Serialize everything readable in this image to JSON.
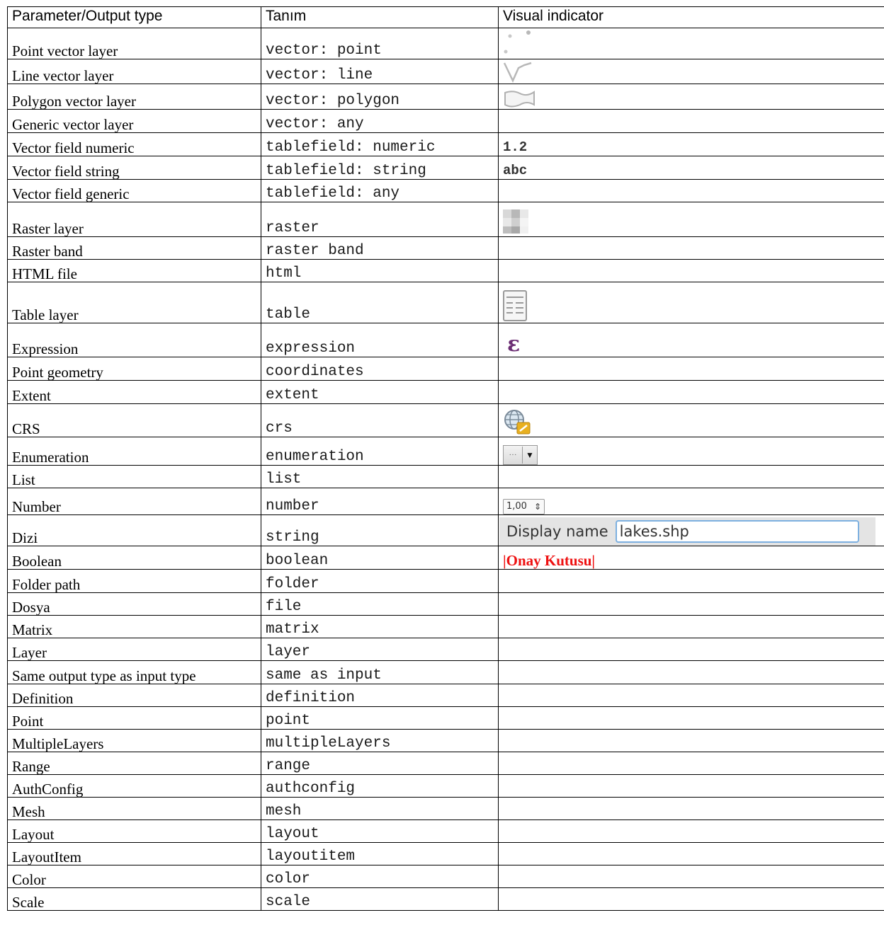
{
  "headers": [
    "Parameter/Output type",
    "Tanım",
    "Visual indicator"
  ],
  "rows": [
    {
      "name": "Point vector layer",
      "code": "vector: point",
      "icon": "point-vector-icon"
    },
    {
      "name": "Line vector layer",
      "code": "vector: line",
      "icon": "line-vector-icon"
    },
    {
      "name": "Polygon vector layer",
      "code": "vector: polygon",
      "icon": "polygon-vector-icon"
    },
    {
      "name": "Generic vector layer",
      "code": "vector: any",
      "icon": ""
    },
    {
      "name": "Vector field numeric",
      "code": "tablefield: numeric",
      "visual_text": "1.2"
    },
    {
      "name": "Vector field string",
      "code": "tablefield: string",
      "visual_text": "abc"
    },
    {
      "name": "Vector field generic",
      "code": "tablefield: any",
      "icon": ""
    },
    {
      "name": "Raster layer",
      "code": "raster",
      "icon": "raster-icon"
    },
    {
      "name": "Raster band",
      "code": "raster band",
      "icon": ""
    },
    {
      "name": "HTML file",
      "code": "html",
      "icon": ""
    },
    {
      "name": "Table layer",
      "code": "table",
      "icon": "table-icon"
    },
    {
      "name": "Expression",
      "code": "expression",
      "icon": "expression-epsilon-icon"
    },
    {
      "name": "Point geometry",
      "code": "coordinates",
      "icon": ""
    },
    {
      "name": "Extent",
      "code": "extent",
      "icon": ""
    },
    {
      "name": "CRS",
      "code": "crs",
      "icon": "crs-globe-icon"
    },
    {
      "name": "Enumeration",
      "code": "enumeration",
      "icon": "enumeration-combo-icon"
    },
    {
      "name": "List",
      "code": "list",
      "icon": ""
    },
    {
      "name": "Number",
      "code": "number",
      "spin_value": "1,00"
    },
    {
      "name": "Dizi",
      "code": "string",
      "display_label": "Display name",
      "display_value": "lakes.shp"
    },
    {
      "name": "Boolean",
      "code": "boolean",
      "visual_text": "|Onay Kutusu|"
    },
    {
      "name": "Folder path",
      "code": "folder",
      "icon": ""
    },
    {
      "name": "Dosya",
      "code": "file",
      "icon": ""
    },
    {
      "name": "Matrix",
      "code": "matrix",
      "icon": ""
    },
    {
      "name": "Layer",
      "code": "layer",
      "icon": ""
    },
    {
      "name": "Same output type as input type",
      "code": "same as input",
      "icon": ""
    },
    {
      "name": "Definition",
      "code": "definition",
      "icon": ""
    },
    {
      "name": "Point",
      "code": "point",
      "icon": ""
    },
    {
      "name": "MultipleLayers",
      "code": "multipleLayers",
      "icon": ""
    },
    {
      "name": "Range",
      "code": "range",
      "icon": ""
    },
    {
      "name": "AuthConfig",
      "code": "authconfig",
      "icon": ""
    },
    {
      "name": "Mesh",
      "code": "mesh",
      "icon": ""
    },
    {
      "name": "Layout",
      "code": "layout",
      "icon": ""
    },
    {
      "name": "LayoutItem",
      "code": "layoutitem",
      "icon": ""
    },
    {
      "name": "Color",
      "code": "color",
      "icon": ""
    },
    {
      "name": "Scale",
      "code": "scale",
      "icon": ""
    }
  ],
  "colors": {
    "error_red": "#ee1111",
    "display_bg": "#e4e4e4",
    "input_border": "#7db0e0",
    "epsilon": "#6b2d73"
  }
}
